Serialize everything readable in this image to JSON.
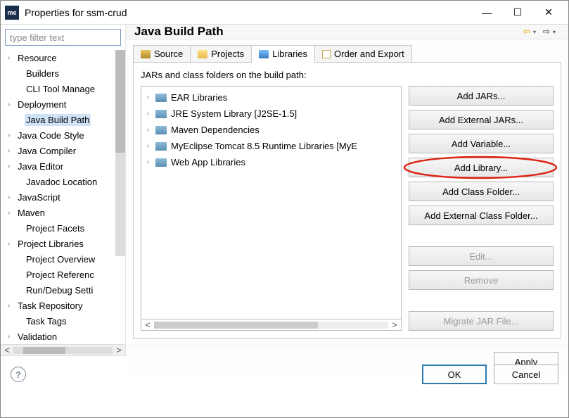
{
  "window": {
    "appicon_text": "me",
    "title": "Properties for ssm-crud"
  },
  "filter": {
    "placeholder": "type filter text"
  },
  "tree": [
    {
      "label": "Resource",
      "expandable": true,
      "child": false,
      "selected": false
    },
    {
      "label": "Builders",
      "expandable": false,
      "child": true,
      "selected": false
    },
    {
      "label": "CLI Tool Manage",
      "expandable": false,
      "child": true,
      "selected": false
    },
    {
      "label": "Deployment",
      "expandable": true,
      "child": false,
      "selected": false
    },
    {
      "label": "Java Build Path",
      "expandable": false,
      "child": true,
      "selected": true
    },
    {
      "label": "Java Code Style",
      "expandable": true,
      "child": false,
      "selected": false
    },
    {
      "label": "Java Compiler",
      "expandable": true,
      "child": false,
      "selected": false
    },
    {
      "label": "Java Editor",
      "expandable": true,
      "child": false,
      "selected": false
    },
    {
      "label": "Javadoc Location",
      "expandable": false,
      "child": true,
      "selected": false
    },
    {
      "label": "JavaScript",
      "expandable": true,
      "child": false,
      "selected": false
    },
    {
      "label": "Maven",
      "expandable": true,
      "child": false,
      "selected": false
    },
    {
      "label": "Project Facets",
      "expandable": false,
      "child": true,
      "selected": false
    },
    {
      "label": "Project Libraries",
      "expandable": true,
      "child": false,
      "selected": false
    },
    {
      "label": "Project Overview",
      "expandable": false,
      "child": true,
      "selected": false
    },
    {
      "label": "Project Referenc",
      "expandable": false,
      "child": true,
      "selected": false
    },
    {
      "label": "Run/Debug Setti",
      "expandable": false,
      "child": true,
      "selected": false
    },
    {
      "label": "Task Repository",
      "expandable": true,
      "child": false,
      "selected": false
    },
    {
      "label": "Task Tags",
      "expandable": false,
      "child": true,
      "selected": false
    },
    {
      "label": "Validation",
      "expandable": true,
      "child": false,
      "selected": false
    }
  ],
  "page": {
    "title": "Java Build Path",
    "tabs": {
      "source": "Source",
      "projects": "Projects",
      "libraries": "Libraries",
      "order": "Order and Export"
    },
    "desc": "JARs and class folders on the build path:",
    "libs": [
      "EAR Libraries",
      "JRE System Library [J2SE-1.5]",
      "Maven Dependencies",
      "MyEclipse Tomcat 8.5 Runtime Libraries [MyE",
      "Web App Libraries"
    ],
    "buttons": {
      "add_jars": "Add JARs...",
      "add_ext_jars": "Add External JARs...",
      "add_var": "Add Variable...",
      "add_lib": "Add Library...",
      "add_class": "Add Class Folder...",
      "add_ext_class": "Add External Class Folder...",
      "edit": "Edit...",
      "remove": "Remove",
      "migrate": "Migrate JAR File..."
    },
    "apply": "Apply"
  },
  "footer": {
    "ok": "OK",
    "cancel": "Cancel",
    "help": "?"
  }
}
